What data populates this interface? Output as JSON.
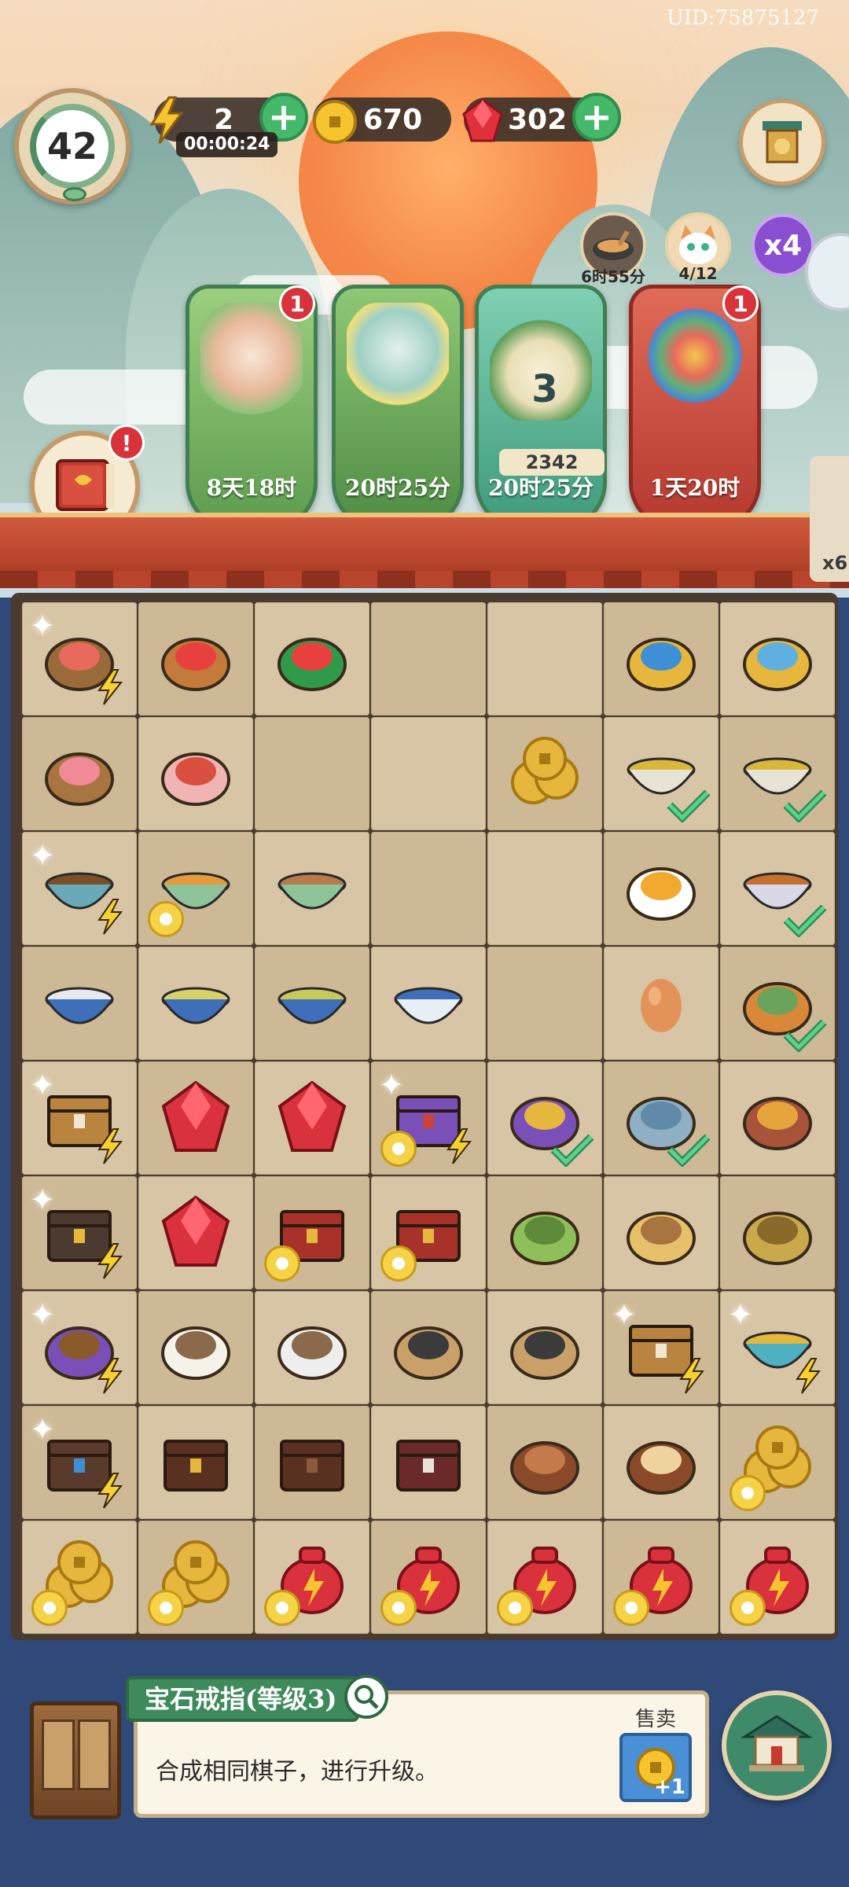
{
  "uid": "UID:75875127",
  "player": {
    "level": "42"
  },
  "resources": {
    "energy": "2",
    "energy_timer": "00:00:24",
    "coins": "670",
    "gems": "302"
  },
  "mini_indicators": [
    {
      "icon": "wok-icon",
      "label": "6时55分"
    },
    {
      "icon": "cat-avatar-icon",
      "label": "4/12"
    },
    {
      "icon": "multiplier-icon",
      "label": "x4"
    }
  ],
  "book_alert": "!",
  "quest_cards": [
    {
      "name": "cat-quest",
      "badge": "1",
      "timer": "8天18时",
      "color": "#7db86e"
    },
    {
      "name": "flower-cat-quest",
      "badge": "",
      "timer": "20时25分",
      "color": "#6aa45c"
    },
    {
      "name": "bonsai-quest",
      "badge": "",
      "number": "3",
      "score": "2342",
      "timer": "20时25分",
      "color": "#5aa88a"
    },
    {
      "name": "paint-quest",
      "badge": "1",
      "timer": "1天20时",
      "color": "#c9463c"
    }
  ],
  "side_counter": "x6",
  "board": {
    "rows": [
      [
        "picnic-basket",
        "watermelon-platter",
        "watermelon-slice",
        "",
        "",
        "bead-bracelet",
        "gold-bracelet"
      ],
      [
        "peach-bun-plate",
        "pig-rice-cake",
        "",
        "",
        "square-hole-coin",
        "fried-rice-bowl",
        "fried-rice-bowl"
      ],
      [
        "teapot-stove",
        "donut-soup-bowl",
        "sweet-soup-bowl",
        "",
        "",
        "fried-egg",
        "roast-chicken-bowl"
      ],
      [
        "porcelain-tea-bowl",
        "green-tea-pot",
        "green-tea-cup",
        "porcelain-cup",
        "",
        "egg",
        "roast-chicken-platter"
      ],
      [
        "scroll-toolbox",
        "ruby-pair",
        "ruby",
        "scroll-box",
        "gem-ring",
        "jade-hook",
        "chicken-coop"
      ],
      [
        "treasure-chest",
        "ruby-cluster",
        "mystery-crate",
        "mystery-crate",
        "bamboo",
        "chick-nest",
        "grain-pile"
      ],
      [
        "silk-loom",
        "cotton",
        "thread-spools",
        "brush",
        "brush-and-ruler",
        "scroll-toolbox",
        "teapot-set"
      ],
      [
        "gem-chest",
        "wooden-box",
        "small-box",
        "jewel-box",
        "empty-nest",
        "egg-nest",
        "coin-stack"
      ],
      [
        "coin-pile",
        "coin-pile",
        "lucky-pouch",
        "lucky-pouch",
        "lucky-pouch",
        "lucky-pouch",
        "lucky-pouch"
      ]
    ]
  },
  "selected_item": {
    "title": "宝石戒指(等级3)",
    "description": "合成相同棋子，进行升级。",
    "sell_label": "售卖",
    "sell_amount": "+1"
  },
  "colors": {
    "accent_green": "#45b86a",
    "alert_red": "#d8323a",
    "board_cell": "#d7c5a6",
    "panel_blue": "#2f4a78"
  }
}
